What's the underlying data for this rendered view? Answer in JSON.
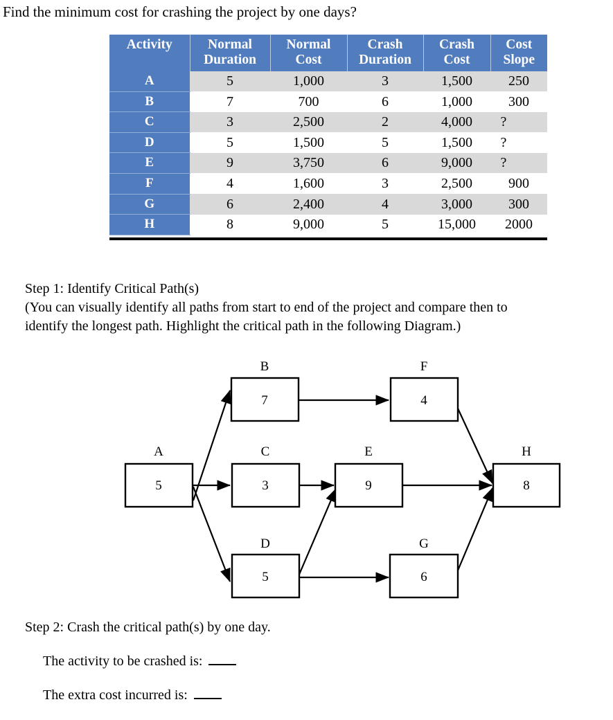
{
  "question": "Find the minimum cost for crashing the project by one days?",
  "table": {
    "columns": [
      {
        "line1": "Activity",
        "line2": ""
      },
      {
        "line1": "Normal",
        "line2": "Duration"
      },
      {
        "line1": "Normal",
        "line2": "Cost"
      },
      {
        "line1": "Crash",
        "line2": "Duration"
      },
      {
        "line1": "Crash",
        "line2": "Cost"
      },
      {
        "line1": "Cost",
        "line2": "Slope"
      }
    ],
    "rows": [
      {
        "activity": "A",
        "normal_duration": "5",
        "normal_cost": "1,000",
        "crash_duration": "3",
        "crash_cost": "1,500",
        "cost_slope": "250"
      },
      {
        "activity": "B",
        "normal_duration": "7",
        "normal_cost": "700",
        "crash_duration": "6",
        "crash_cost": "1,000",
        "cost_slope": "300"
      },
      {
        "activity": "C",
        "normal_duration": "3",
        "normal_cost": "2,500",
        "crash_duration": "2",
        "crash_cost": "4,000",
        "cost_slope": "?"
      },
      {
        "activity": "D",
        "normal_duration": "5",
        "normal_cost": "1,500",
        "crash_duration": "5",
        "crash_cost": "1,500",
        "cost_slope": "?"
      },
      {
        "activity": "E",
        "normal_duration": "9",
        "normal_cost": "3,750",
        "crash_duration": "6",
        "crash_cost": "9,000",
        "cost_slope": "?"
      },
      {
        "activity": "F",
        "normal_duration": "4",
        "normal_cost": "1,600",
        "crash_duration": "3",
        "crash_cost": "2,500",
        "cost_slope": "900"
      },
      {
        "activity": "G",
        "normal_duration": "6",
        "normal_cost": "2,400",
        "crash_duration": "4",
        "crash_cost": "3,000",
        "cost_slope": "300"
      },
      {
        "activity": "H",
        "normal_duration": "8",
        "normal_cost": "9,000",
        "crash_duration": "5",
        "crash_cost": "15,000",
        "cost_slope": "2000"
      }
    ],
    "header_color": "#517CBE",
    "band_color": "#D9D9D9"
  },
  "step1": {
    "title": "Step 1: Identify Critical Path(s)",
    "line1": "(You can visually identify all paths from start to end of the project and compare then to",
    "line2": "identify the longest path.  Highlight the critical path in the following Diagram.)"
  },
  "diagram": {
    "nodes": [
      {
        "id": "A",
        "label": "A",
        "duration": "5"
      },
      {
        "id": "B",
        "label": "B",
        "duration": "7"
      },
      {
        "id": "C",
        "label": "C",
        "duration": "3"
      },
      {
        "id": "D",
        "label": "D",
        "duration": "5"
      },
      {
        "id": "E",
        "label": "E",
        "duration": "9"
      },
      {
        "id": "F",
        "label": "F",
        "duration": "4"
      },
      {
        "id": "G",
        "label": "G",
        "duration": "6"
      },
      {
        "id": "H",
        "label": "H",
        "duration": "8"
      }
    ],
    "edges": [
      {
        "from": "A",
        "to": "B"
      },
      {
        "from": "A",
        "to": "C"
      },
      {
        "from": "A",
        "to": "D"
      },
      {
        "from": "B",
        "to": "F"
      },
      {
        "from": "C",
        "to": "E"
      },
      {
        "from": "D",
        "to": "E"
      },
      {
        "from": "D",
        "to": "G"
      },
      {
        "from": "E",
        "to": "H"
      },
      {
        "from": "F",
        "to": "H"
      },
      {
        "from": "G",
        "to": "H"
      }
    ]
  },
  "step2": {
    "title": "Step 2: Crash the critical path(s) by one day.",
    "line1": "The activity to be crashed is:",
    "line2": "The extra cost incurred is:"
  }
}
